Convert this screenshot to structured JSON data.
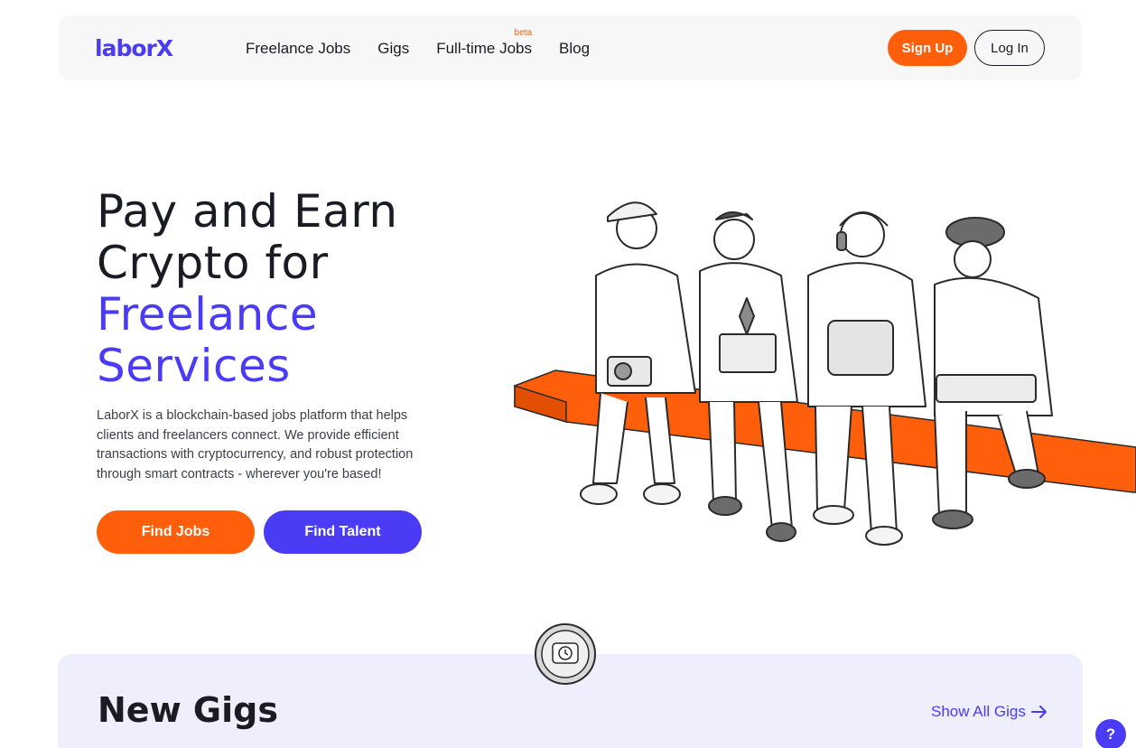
{
  "brand": {
    "logo_text": "laborX",
    "accent_color": "#4a3bf5",
    "orange_color": "#ff5f0a"
  },
  "nav": {
    "links": [
      "Freelance Jobs",
      "Gigs",
      "Full-time Jobs",
      "Blog"
    ],
    "beta_badge": "beta",
    "signup_label": "Sign Up",
    "login_label": "Log In"
  },
  "hero": {
    "title_lines": [
      "Pay and Earn",
      "Crypto for"
    ],
    "title_accent_lines": [
      "Freelance",
      "Services"
    ],
    "description": "LaborX is a blockchain-based jobs platform that helps clients and freelancers connect. We provide efficient transactions with cryptocurrency, and robust protection through smart contracts - wherever you're based!",
    "find_jobs_label": "Find Jobs",
    "find_talent_label": "Find Talent"
  },
  "gigs": {
    "title": "New Gigs",
    "show_all_label": "Show All Gigs"
  },
  "help": {
    "label": "?"
  }
}
